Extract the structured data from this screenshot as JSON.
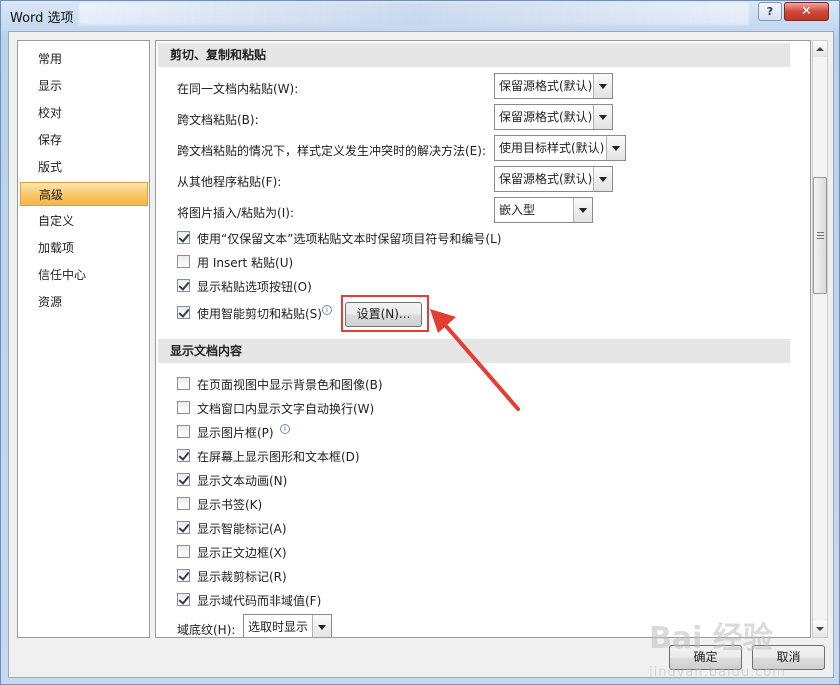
{
  "window": {
    "title": "Word 选项",
    "help_glyph": "?",
    "close_glyph": "✕"
  },
  "sidebar": {
    "items": [
      {
        "label": "常用"
      },
      {
        "label": "显示"
      },
      {
        "label": "校对"
      },
      {
        "label": "保存"
      },
      {
        "label": "版式"
      },
      {
        "label": "高级",
        "active": true
      },
      {
        "label": "自定义"
      },
      {
        "label": "加载项"
      },
      {
        "label": "信任中心"
      },
      {
        "label": "资源"
      }
    ]
  },
  "paste_section": {
    "header": "剪切、复制和粘贴",
    "options": [
      {
        "label": "在同一文档内粘贴(W):",
        "value": "保留源格式(默认)"
      },
      {
        "label": "跨文档粘贴(B):",
        "value": "保留源格式(默认)"
      },
      {
        "label": "跨文档粘贴的情况下，样式定义发生冲突时的解决方法(E):",
        "value": "使用目标样式(默认)"
      },
      {
        "label": "从其他程序粘贴(F):",
        "value": "保留源格式(默认)"
      },
      {
        "label": "将图片插入/粘贴为(I):",
        "value": "嵌入型"
      }
    ],
    "checkboxes": [
      {
        "label": "使用“仅保留文本”选项粘贴文本时保留项目符号和编号(L)",
        "checked": true
      },
      {
        "label": "用 Insert 粘贴(U)",
        "checked": false
      },
      {
        "label": "显示粘贴选项按钮(O)",
        "checked": true
      },
      {
        "label": "使用智能剪切和粘贴(S)",
        "checked": true
      }
    ],
    "settings_button": "设置(N)..."
  },
  "display_section": {
    "header": "显示文档内容",
    "checkboxes": [
      {
        "label": "在页面视图中显示背景色和图像(B)",
        "checked": false
      },
      {
        "label": "文档窗口内显示文字自动换行(W)",
        "checked": false
      },
      {
        "label": "显示图片框(P)",
        "checked": false
      },
      {
        "label": "在屏幕上显示图形和文本框(D)",
        "checked": true
      },
      {
        "label": "显示文本动画(N)",
        "checked": true
      },
      {
        "label": "显示书签(K)",
        "checked": false
      },
      {
        "label": "显示智能标记(A)",
        "checked": true
      },
      {
        "label": "显示正文边框(X)",
        "checked": false
      },
      {
        "label": "显示裁剪标记(R)",
        "checked": true
      },
      {
        "label": "显示域代码而非域值(F)",
        "checked": true
      }
    ],
    "field_shading": {
      "label": "域底纹(H):",
      "value": "选取时显示"
    }
  },
  "footer": {
    "ok": "确定",
    "cancel": "取消"
  },
  "info_glyph": "i",
  "watermark": {
    "text": "Bai 经验",
    "sub": "jingyan.baidu.com"
  },
  "colors": {
    "highlight_red": "#e53c33",
    "active_nav": "#f8c86a"
  }
}
